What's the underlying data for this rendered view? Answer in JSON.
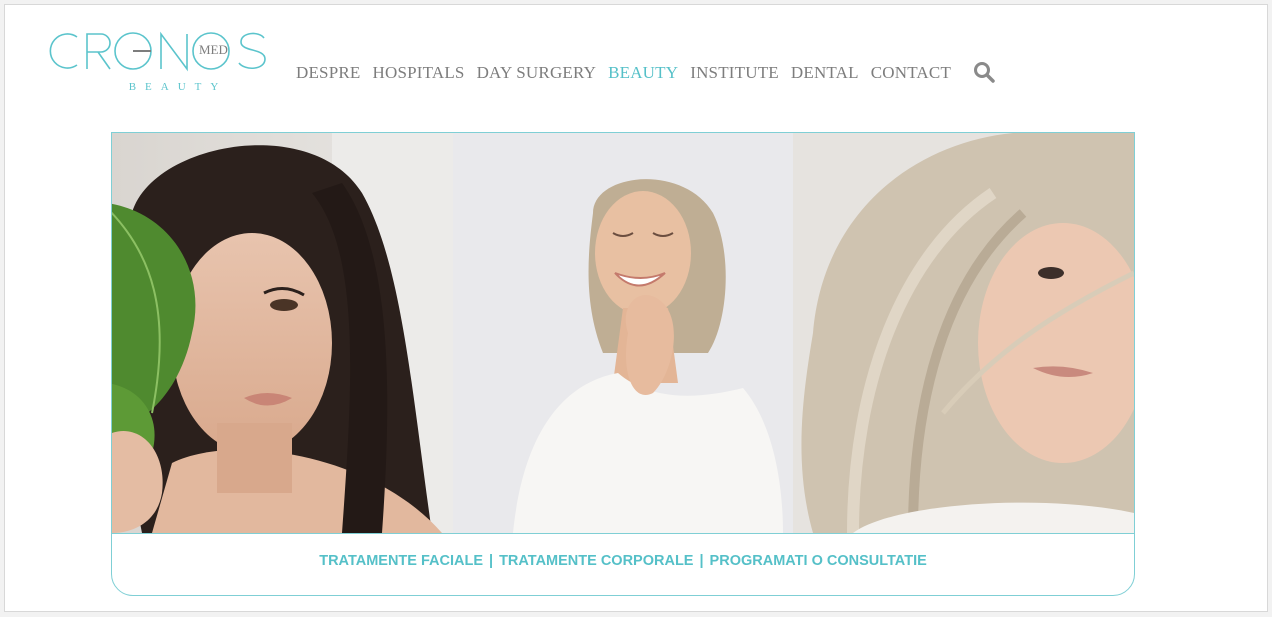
{
  "brand": {
    "logo_main": "CRGNOS",
    "logo_badge": "MED",
    "logo_sub": "BEAUTY",
    "accent": "#55c0c8",
    "text_gray": "#7d7d7d"
  },
  "nav": {
    "items": [
      {
        "label": "DESPRE",
        "active": false
      },
      {
        "label": "HOSPITALS",
        "active": false
      },
      {
        "label": "DAY SURGERY",
        "active": false
      },
      {
        "label": "BEAUTY",
        "active": true
      },
      {
        "label": "INSTITUTE",
        "active": false
      },
      {
        "label": "DENTAL",
        "active": false
      },
      {
        "label": "CONTACT",
        "active": false
      }
    ],
    "search_icon": "search-icon"
  },
  "hero": {
    "photos": [
      "woman-with-leaf-photo",
      "smiling-blonde-woman-photo",
      "gray-haired-woman-photo"
    ],
    "links": [
      {
        "label": "TRATAMENTE FACIALE"
      },
      {
        "label": "TRATAMENTE CORPORALE"
      },
      {
        "label": "PROGRAMATI O CONSULTATIE"
      }
    ],
    "separator": "|"
  }
}
